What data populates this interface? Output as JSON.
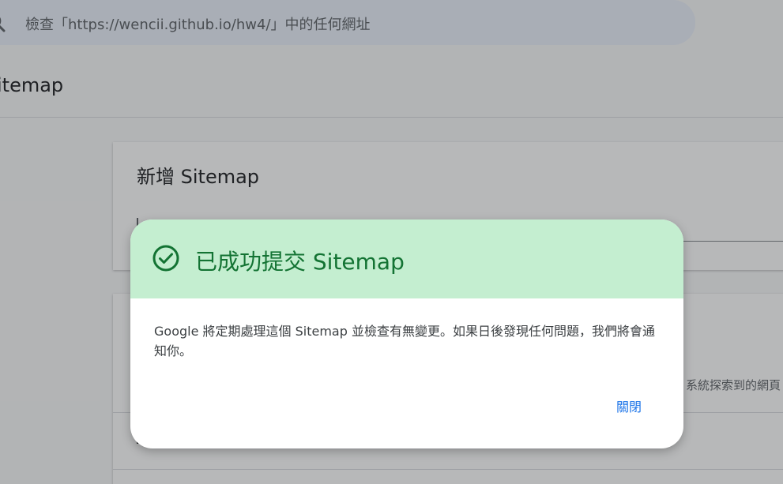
{
  "search": {
    "placeholder": "檢查「https://wencii.github.io/hw4/」中的任何網址"
  },
  "page": {
    "title": "itemap"
  },
  "add_card": {
    "title": "新增 Sitemap"
  },
  "list_card": {
    "hint": "系統探索到的網頁"
  },
  "dialog": {
    "title": "已成功提交 Sitemap",
    "body": "Google 將定期處理這個 Sitemap 並檢查有無變更。如果日後發現任何問題，我們將會通知你。",
    "close_label": "關閉"
  },
  "colors": {
    "success_bg": "#c4eed0",
    "success_text": "#137333",
    "link_blue": "#1a73e8"
  },
  "icons": {
    "search": "search-icon",
    "success": "check-circle-icon"
  }
}
